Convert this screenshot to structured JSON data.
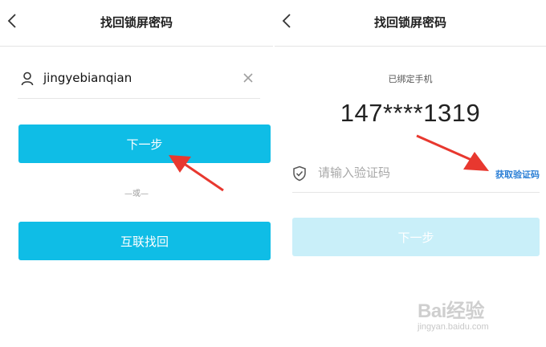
{
  "left_screen": {
    "title": "找回锁屏密码",
    "username": "jingyebianqian",
    "next_label": "下一步",
    "or_text": "—或—",
    "link_label": "互联找回"
  },
  "right_screen": {
    "title": "找回锁屏密码",
    "bound_phone_label": "已绑定手机",
    "phone_number": "147****1319",
    "code_placeholder": "请输入验证码",
    "get_code_label": "获取验证码",
    "next_label": "下一步"
  },
  "watermark": {
    "logo": "Bai经验",
    "site": "jingyan.baidu.com"
  },
  "colors": {
    "primary": "#0fbde6",
    "disabled": "#c9eff9",
    "link": "#2b7fd6",
    "annotation_arrow": "#e8382f"
  },
  "icons": [
    "back-arrow-icon",
    "user-icon",
    "clear-icon",
    "shield-check-icon"
  ]
}
